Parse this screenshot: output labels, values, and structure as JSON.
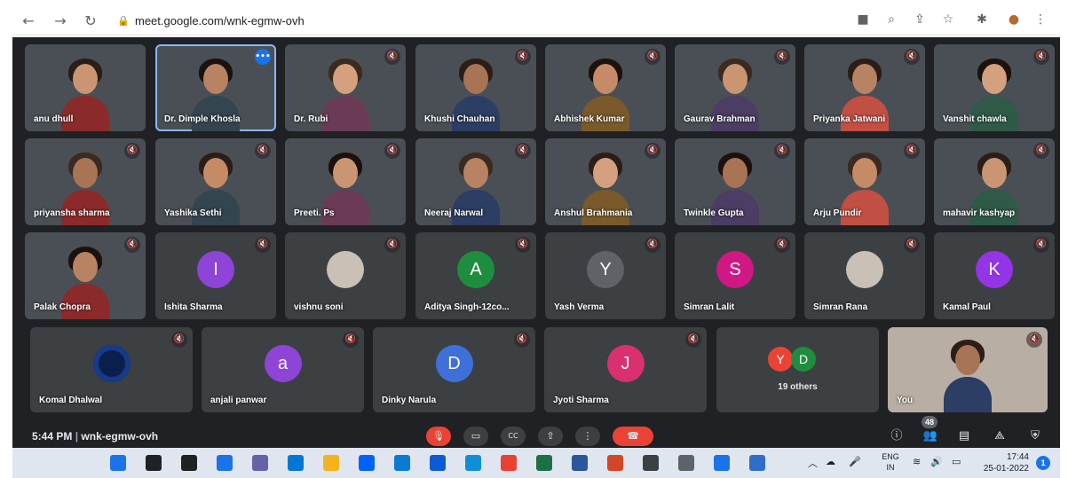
{
  "browser": {
    "url": "meet.google.com/wnk-egmw-ovh",
    "icons": [
      "back-arrow-icon",
      "forward-arrow-icon",
      "reload-icon",
      "lock-icon",
      "camera-icon",
      "zoom-icon",
      "share-icon",
      "star-icon",
      "extensions-icon",
      "profile-icon",
      "menu-icon"
    ]
  },
  "participants": [
    {
      "name": "anu dhull",
      "type": "video",
      "muted": false,
      "speaking": false
    },
    {
      "name": "Dr. Dimple Khosla",
      "type": "video",
      "muted": false,
      "speaking": true
    },
    {
      "name": "Dr. Rubi",
      "type": "video",
      "muted": true
    },
    {
      "name": "Khushi Chauhan",
      "type": "video",
      "muted": true
    },
    {
      "name": "Abhishek Kumar",
      "type": "video",
      "muted": true
    },
    {
      "name": "Gaurav Brahman",
      "type": "video",
      "muted": true
    },
    {
      "name": "Priyanka Jatwani",
      "type": "video",
      "muted": true
    },
    {
      "name": "Vanshit chawla",
      "type": "video",
      "muted": true
    },
    {
      "name": "priyansha sharma",
      "type": "video",
      "muted": true
    },
    {
      "name": "Yashika Sethi",
      "type": "video",
      "muted": true
    },
    {
      "name": "Preeti. Ps",
      "type": "video",
      "muted": true
    },
    {
      "name": "Neeraj Narwal",
      "type": "video",
      "muted": true
    },
    {
      "name": "Anshul Brahmania",
      "type": "video",
      "muted": true
    },
    {
      "name": "Twinkle Gupta",
      "type": "video",
      "muted": true
    },
    {
      "name": "Arju Pundir",
      "type": "video",
      "muted": true
    },
    {
      "name": "mahavir kashyap",
      "type": "video",
      "muted": true
    },
    {
      "name": "Palak Chopra",
      "type": "video",
      "muted": true
    },
    {
      "name": "Ishita Sharma",
      "type": "avatar",
      "initial": "I",
      "color": "#8e44d6",
      "muted": true
    },
    {
      "name": "vishnu soni",
      "type": "photo",
      "muted": true
    },
    {
      "name": "Aditya Singh-12co...",
      "type": "avatar",
      "initial": "A",
      "color": "#1e8e3e",
      "muted": true
    },
    {
      "name": "Yash Verma",
      "type": "avatar",
      "initial": "Y",
      "color": "#5f6368",
      "muted": true
    },
    {
      "name": "Simran Lalit",
      "type": "avatar",
      "initial": "S",
      "color": "#d01884",
      "muted": true
    },
    {
      "name": "Simran Rana",
      "type": "photo",
      "muted": true
    },
    {
      "name": "Kamal Paul",
      "type": "avatar",
      "initial": "K",
      "color": "#9334e6",
      "muted": true
    },
    {
      "name": "Komal Dhalwal",
      "type": "photo",
      "muted": true
    },
    {
      "name": "anjali panwar",
      "type": "avatar",
      "initial": "a",
      "color": "#8e44d6",
      "muted": true
    },
    {
      "name": "Dinky Narula",
      "type": "avatar",
      "initial": "D",
      "color": "#3f6fd8",
      "muted": true
    },
    {
      "name": "Jyoti Sharma",
      "type": "avatar",
      "initial": "J",
      "color": "#d93070",
      "muted": true
    }
  ],
  "others": {
    "initials": [
      "Y",
      "D"
    ],
    "colors": [
      "#ea4335",
      "#1e8e3e"
    ],
    "label": "19 others"
  },
  "self": {
    "name": "You"
  },
  "meetbar": {
    "time": "5:44 PM",
    "separator": "|",
    "code": "wnk-egmw-ovh",
    "controls": [
      "mic-off-icon",
      "camera-off-icon",
      "captions-icon",
      "present-icon",
      "more-options-icon",
      "end-call-icon"
    ],
    "cc_label": "CC",
    "right_icons": [
      "info-icon",
      "people-icon",
      "chat-icon",
      "activities-icon",
      "host-controls-icon"
    ],
    "participant_count": "48"
  },
  "taskbar": {
    "apps": [
      {
        "name": "start-icon",
        "color": "#1a73e8"
      },
      {
        "name": "search-icon",
        "color": "#202124"
      },
      {
        "name": "task-view-icon",
        "color": "#202124"
      },
      {
        "name": "widgets-icon",
        "color": "#1a73e8"
      },
      {
        "name": "teams-chat-icon",
        "color": "#6264a7"
      },
      {
        "name": "store-icon",
        "color": "#0078d4"
      },
      {
        "name": "file-explorer-icon",
        "color": "#f3b31b"
      },
      {
        "name": "dropbox-icon",
        "color": "#0061ff"
      },
      {
        "name": "photos-icon",
        "color": "#0a7bd5"
      },
      {
        "name": "mail-icon",
        "color": "#0a5bd5"
      },
      {
        "name": "edge-icon",
        "color": "#0f8fd8"
      },
      {
        "name": "chrome-icon",
        "color": "#e94235"
      },
      {
        "name": "excel-icon",
        "color": "#1d7044"
      },
      {
        "name": "word-icon",
        "color": "#2b579a"
      },
      {
        "name": "powerpoint-icon",
        "color": "#d24726"
      },
      {
        "name": "calculator-icon",
        "color": "#3c4043"
      },
      {
        "name": "settings-icon",
        "color": "#5f6368"
      },
      {
        "name": "calendar-icon",
        "color": "#1a73e8"
      },
      {
        "name": "notepad-icon",
        "color": "#2e6dc8"
      }
    ],
    "tray": {
      "lang_top": "ENG",
      "lang_bottom": "IN",
      "time": "17:44",
      "date": "25-01-2022",
      "notification_count": "1"
    }
  }
}
